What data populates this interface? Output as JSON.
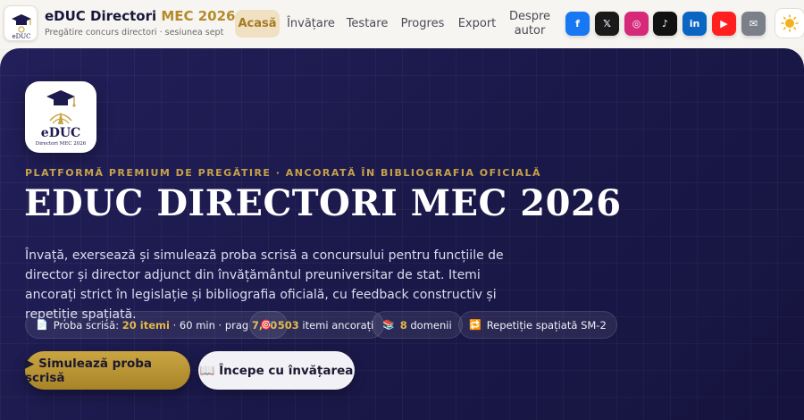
{
  "header": {
    "brand_title": "eDUC Directori",
    "brand_title_accent": "MEC 2026",
    "brand_subtitle": "Pregătire concurs directori · sesiunea sept"
  },
  "nav": {
    "items": [
      {
        "label": "Acasă",
        "active": true
      },
      {
        "label": "Învățare"
      },
      {
        "label": "Testare"
      },
      {
        "label": "Progres"
      },
      {
        "label": "Export"
      },
      {
        "label": "Despre autor"
      }
    ]
  },
  "social": [
    {
      "name": "facebook",
      "glyph": "f",
      "color": "#1877f2"
    },
    {
      "name": "x",
      "glyph": "𝕏",
      "color": "#1a1a1a"
    },
    {
      "name": "instagram",
      "glyph": "◎",
      "color": "#d6297a"
    },
    {
      "name": "tiktok",
      "glyph": "♪",
      "color": "#111111"
    },
    {
      "name": "linkedin",
      "glyph": "in",
      "color": "#0a66c2"
    },
    {
      "name": "youtube",
      "glyph": "▶",
      "color": "#ff1f1f"
    },
    {
      "name": "email",
      "glyph": "✉",
      "color": "#7b7f8a"
    }
  ],
  "theme_toggle_icon": "sun-icon",
  "hero": {
    "logo_wordmark": "eDUC",
    "logo_caption": "Directori MEC 2026",
    "eyebrow": "PLATFORMĂ PREMIUM DE PREGĂTIRE · ANCORATĂ ÎN BIBLIOGRAFIA OFICIALĂ",
    "title": "EDUC DIRECTORI MEC 2026",
    "description": "Învață, exersează și simulează proba scrisă a concursului pentru funcțiile de director și director adjunct din învățământul preuniversitar de stat. Itemi ancorați strict în legislație și bibliografia oficială, cu feedback constructiv și repetiție spațiată.",
    "chips": {
      "exam_label": "Proba scrisă:",
      "exam_items": "20 itemi",
      "exam_mid": "· 60 min · prag",
      "exam_threshold": "7,00",
      "items_count": "503",
      "items_label": "itemi ancorați",
      "domains_count": "8",
      "domains_label": "domenii",
      "repetition_label": "Repetiție spațiată SM-2"
    },
    "buttons": {
      "primary": "▶ Simulează proba scrisă",
      "secondary": "📖 Începe cu învățarea"
    }
  },
  "colors": {
    "hero_bg": "#1c1a4c",
    "accent_gold": "#c9a542",
    "brand_navy": "#16163a"
  }
}
